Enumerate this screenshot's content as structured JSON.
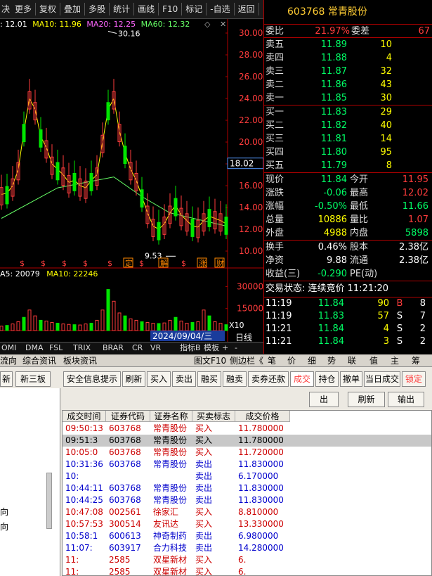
{
  "toolbar": [
    "更多",
    "复权",
    "叠加",
    "多股",
    "统计",
    "画线",
    "F10",
    "标记",
    "-自选",
    "返回"
  ],
  "toolbar_lead": "决",
  "legend": {
    "ma5": ": 12.01",
    "ma10": "MA10: 11.96",
    "ma20": "MA20: 12.25",
    "ma60": "MA60: 12.32"
  },
  "price_axis": [
    "30.00",
    "28.00",
    "26.00",
    "24.00",
    "22.00",
    "20.00",
    "18.00",
    "16.00",
    "14.00",
    "12.00",
    "10.00"
  ],
  "price_marker": "18.02",
  "chart_labels": {
    "high": "30.16",
    "low": "9.53",
    "date": "2024/09/04/三"
  },
  "events": [
    "$",
    "$",
    "$",
    "$",
    "$",
    "定",
    "$",
    "解",
    "$",
    "涨",
    "财"
  ],
  "vol_legend": {
    "ma5": "A5: 20079",
    "ma10": "MA10: 22246"
  },
  "vol_axis": [
    "30000",
    "15000"
  ],
  "vol_unit": "X10",
  "chart_period": "日线",
  "chart_data": [
    {
      "type": "line",
      "title": "",
      "series": [
        {
          "name": "MA10",
          "x": [
            0,
            1,
            2,
            3,
            4,
            5,
            6,
            7,
            8,
            9,
            10,
            11,
            12,
            13,
            14,
            15,
            16,
            17,
            18,
            19,
            20,
            21,
            22,
            23,
            24,
            25,
            26,
            27,
            28,
            29,
            30,
            31,
            32,
            33,
            34,
            35,
            36,
            37,
            38,
            39,
            40
          ],
          "values": [
            15.2,
            15.3,
            16,
            17.5,
            21,
            24,
            23,
            20.5,
            19.5,
            18,
            17.5,
            17,
            16.3,
            16.5,
            16,
            15.8,
            16.5,
            17,
            20,
            23,
            24,
            21,
            19,
            17.5,
            16.5,
            15,
            13.5,
            12.3,
            12,
            12.5,
            13.5,
            14.2,
            13.3,
            12.8,
            12.3,
            12.2,
            12.8,
            13.2,
            13,
            12.8,
            12.5
          ]
        },
        {
          "name": "MA60",
          "x": [
            0,
            10,
            20,
            25,
            30,
            40
          ],
          "values": [
            13,
            15.8,
            16.8,
            15,
            13.5,
            12.3
          ]
        }
      ],
      "ylim": [
        10,
        30
      ]
    },
    {
      "type": "bar",
      "title": "",
      "series": [
        {
          "name": "VOL",
          "values": [
            3000,
            3500,
            4500,
            6000,
            9000,
            14000,
            10000,
            7000,
            6500,
            5500,
            5000,
            4500,
            4200,
            4000,
            3800,
            4500,
            5000,
            7000,
            14000,
            28000,
            20000,
            12000,
            10000,
            8000,
            7000,
            6000,
            5500,
            5000,
            4800,
            5200,
            7000,
            9000,
            6500,
            5000,
            5500,
            6000,
            14000,
            10000,
            6000,
            5000,
            4000
          ]
        }
      ],
      "ylim": [
        0,
        35000
      ]
    }
  ],
  "indicator_tabs": [
    "OMI",
    "DMA",
    "FSL",
    "TRIX",
    "BRAR",
    "CR",
    "VR",
    "指标B",
    "模板",
    "+",
    "-"
  ],
  "sub_tabs": [
    "流向",
    "综合资讯",
    "板块资讯"
  ],
  "sub_tabs_right": [
    "图文F10",
    "侧边栏《",
    "笔",
    "价",
    "细",
    "势",
    "联",
    "值",
    "主",
    "筹"
  ],
  "quote": {
    "title": "603768 常青股份",
    "weibi_label": "委比",
    "weibi": "21.97%",
    "weicha_label": "委差",
    "weicha": "67",
    "asks": [
      {
        "l": "卖五",
        "p": "11.89",
        "v": "10"
      },
      {
        "l": "卖四",
        "p": "11.88",
        "v": "4"
      },
      {
        "l": "卖三",
        "p": "11.87",
        "v": "32"
      },
      {
        "l": "卖二",
        "p": "11.86",
        "v": "43"
      },
      {
        "l": "卖一",
        "p": "11.85",
        "v": "30"
      }
    ],
    "bids": [
      {
        "l": "买一",
        "p": "11.83",
        "v": "29"
      },
      {
        "l": "买二",
        "p": "11.82",
        "v": "40"
      },
      {
        "l": "买三",
        "p": "11.81",
        "v": "14"
      },
      {
        "l": "买四",
        "p": "11.80",
        "v": "95"
      },
      {
        "l": "买五",
        "p": "11.79",
        "v": "8"
      }
    ],
    "stats": [
      {
        "l1": "现价",
        "v1": "11.84",
        "l2": "今开",
        "v2": "11.95"
      },
      {
        "l1": "涨跌",
        "v1": "-0.06",
        "l2": "最高",
        "v2": "12.02"
      },
      {
        "l1": "涨幅",
        "v1": "-0.50%",
        "l2": "最低",
        "v2": "11.66"
      },
      {
        "l1": "总量",
        "v1": "10886",
        "l2": "量比",
        "v2": "1.07"
      },
      {
        "l1": "外盘",
        "v1": "4988",
        "l2": "内盘",
        "v2": "5898"
      }
    ],
    "stats2": [
      {
        "l1": "换手",
        "v1": "0.46%",
        "l2": "股本",
        "v2": "2.38亿"
      },
      {
        "l1": "净资",
        "v1": "9.88",
        "l2": "流通",
        "v2": "2.38亿"
      },
      {
        "l1": "收益(三)",
        "v1": "-0.290",
        "l2": "PE(动)",
        "v2": ""
      }
    ],
    "trade_status": "交易状态: 连续竞价 11:21:20",
    "ticks": [
      {
        "t": "11:19",
        "p": "11.84",
        "v": "90",
        "d": "B",
        "n": "8"
      },
      {
        "t": "11:19",
        "p": "11.83",
        "v": "57",
        "d": "S",
        "n": "7"
      },
      {
        "t": "11:21",
        "p": "11.84",
        "v": "4",
        "d": "S",
        "n": "2"
      },
      {
        "t": "11:21",
        "p": "11.84",
        "v": "3",
        "d": "S",
        "n": "2"
      }
    ]
  },
  "trade_tabs": [
    "安全信息提示",
    "刷新",
    "买入",
    "卖出",
    "融买",
    "融卖",
    "卖券还款",
    "成交",
    "持仓",
    "撤单",
    "当日成交",
    "锁定"
  ],
  "left_buttons": [
    "新",
    "新三板"
  ],
  "side_labels": [
    "向",
    "向"
  ],
  "grid_actions": [
    "出",
    "刷新",
    "输出"
  ],
  "grid_headers": [
    "成交时间",
    "证券代码",
    "证券名称",
    "买卖标志",
    "成交价格"
  ],
  "grid_rows": [
    {
      "time": "09:50:13",
      "code": "603768",
      "name": "常青股份",
      "flag": "买入",
      "price": "11.780000"
    },
    {
      "time": "09:51:3",
      "code": "603768",
      "name": "常青股份",
      "flag": "买入",
      "price": "11.780000"
    },
    {
      "time": "10:05:0",
      "code": "603768",
      "name": "常青股份",
      "flag": "买入",
      "price": "11.720000"
    },
    {
      "time": "10:31:36",
      "code": "603768",
      "name": "常青股份",
      "flag": "卖出",
      "price": "11.830000"
    },
    {
      "time": "10:",
      "code": "",
      "name": "",
      "flag": "卖出",
      "price": "6.170000"
    },
    {
      "time": "10:44:11",
      "code": "603768",
      "name": "常青股份",
      "flag": "卖出",
      "price": "11.830000"
    },
    {
      "time": "10:44:25",
      "code": "603768",
      "name": "常青股份",
      "flag": "卖出",
      "price": "11.830000"
    },
    {
      "time": "10:47:08",
      "code": "002561",
      "name": "徐家汇",
      "flag": "买入",
      "price": "8.810000"
    },
    {
      "time": "10:57:53",
      "code": "300514",
      "name": "友讯达",
      "flag": "买入",
      "price": "13.330000"
    },
    {
      "time": "10:58:1",
      "code": "600613",
      "name": "神奇制药",
      "flag": "卖出",
      "price": "6.980000"
    },
    {
      "time": "11:07:",
      "code": "603917",
      "name": "合力科技",
      "flag": "卖出",
      "price": "14.280000"
    },
    {
      "time": "11:",
      "code": "2585",
      "name": "双星新材",
      "flag": "买入",
      "price": "6."
    },
    {
      "time": "11:",
      "code": "2585",
      "name": "双星新材",
      "flag": "买入",
      "price": "6."
    }
  ],
  "colors": {
    "up": "#ff3c3c",
    "down": "#00e600",
    "cyan": "#00ffff",
    "yellow": "#ffff00",
    "magenta": "#ff66ff",
    "green": "#66ff66",
    "orange": "#ff8800"
  }
}
